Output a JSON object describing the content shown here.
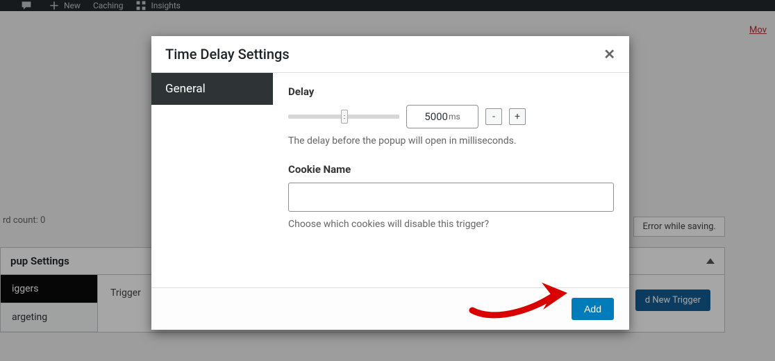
{
  "adminbar": {
    "items": [
      "",
      "New",
      "Caching",
      "Insights"
    ]
  },
  "topright_link": "Mov",
  "wordcount": "rd count: 0",
  "error_msg": "Error while saving.",
  "panel": {
    "title": "pup Settings",
    "tabs": [
      "iggers",
      "argeting"
    ],
    "trigger_label": "Trigger",
    "new_trigger": "d New Trigger"
  },
  "modal": {
    "title": "Time Delay Settings",
    "tab_general": "General",
    "delay_label": "Delay",
    "delay_value": "5000",
    "delay_unit": "ms",
    "minus": "-",
    "plus": "+",
    "delay_help": "The delay before the popup will open in milliseconds.",
    "cookie_label": "Cookie Name",
    "cookie_value": "",
    "cookie_help": "Choose which cookies will disable this trigger?",
    "add_btn": "Add"
  }
}
